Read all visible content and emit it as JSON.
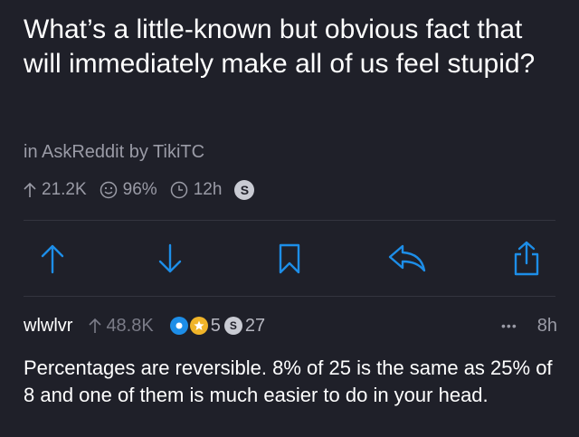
{
  "post": {
    "title": "What’s a little-known but obvious fact that will immediately make all of us feel stupid?",
    "meta": "in AskReddit by TikiTC",
    "score": "21.2K",
    "upvote_ratio": "96%",
    "age": "12h",
    "silver_badge": "S"
  },
  "actions": [
    "upvote-icon",
    "downvote-icon",
    "bookmark-icon",
    "reply-icon",
    "share-icon"
  ],
  "comment": {
    "author": "wlwlvr",
    "score": "48.8K",
    "award_gold_count": "5",
    "award_silver_letter": "S",
    "award_silver_count": "27",
    "more": "•••",
    "age": "8h",
    "body": "Percentages are reversible.  8% of 25 is the same as 25% of 8 and one of them is much easier to do in your head."
  },
  "colors": {
    "background": "#1f2029",
    "accent": "#1d8ee8",
    "muted": "#9a9ba6",
    "divider": "#33343f"
  }
}
